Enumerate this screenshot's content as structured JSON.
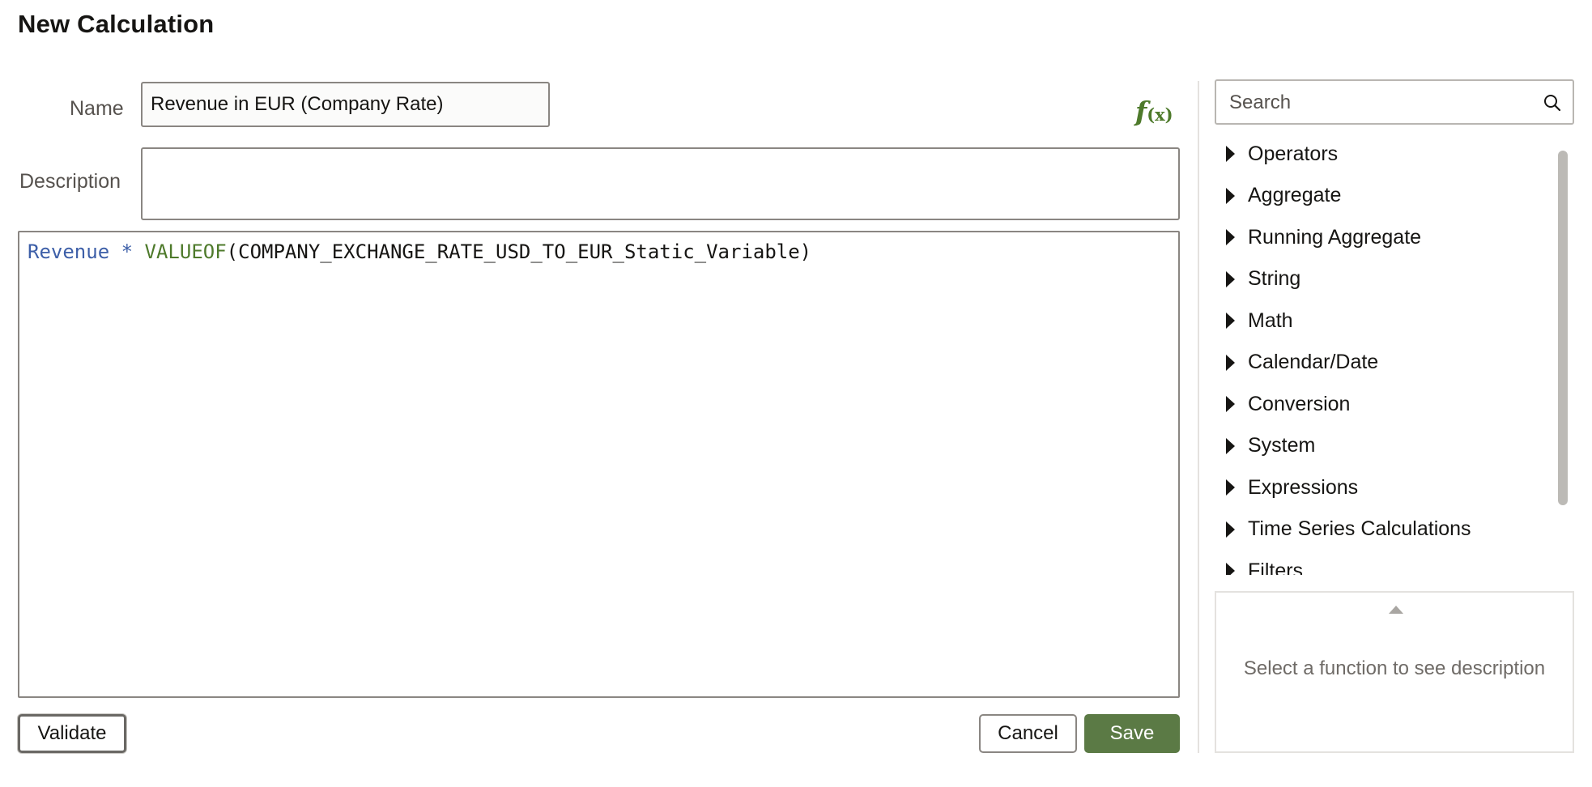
{
  "header": {
    "title": "New Calculation"
  },
  "form": {
    "name_label": "Name",
    "name_value": "Revenue in EUR (Company Rate)",
    "description_label": "Description",
    "description_value": "",
    "fx_icon": "function-icon",
    "fx_f": "f",
    "fx_x": "(x)"
  },
  "editor": {
    "tokens": [
      {
        "type": "column",
        "text": "Revenue"
      },
      {
        "type": "space",
        "text": " "
      },
      {
        "type": "operator",
        "text": "*"
      },
      {
        "type": "space",
        "text": " "
      },
      {
        "type": "function",
        "text": "VALUEOF"
      },
      {
        "type": "text",
        "text": "(COMPANY_EXCHANGE_RATE_USD_TO_EUR_Static_Variable)"
      }
    ],
    "colors": {
      "column": "#3d5fa8",
      "operator": "#3d5fa8",
      "function": "#4e7a2b",
      "text": "#161513"
    }
  },
  "buttons": {
    "validate": "Validate",
    "cancel": "Cancel",
    "save": "Save"
  },
  "colors": {
    "save_bg": "#5b7a45",
    "accent_green": "#4e7a2b"
  },
  "sidebar": {
    "search": {
      "placeholder": "Search",
      "value": "",
      "icon": "search-icon"
    },
    "functions": [
      {
        "label": "Operators"
      },
      {
        "label": "Aggregate"
      },
      {
        "label": "Running Aggregate"
      },
      {
        "label": "String"
      },
      {
        "label": "Math"
      },
      {
        "label": "Calendar/Date"
      },
      {
        "label": "Conversion"
      },
      {
        "label": "System"
      },
      {
        "label": "Expressions"
      },
      {
        "label": "Time Series Calculations"
      },
      {
        "label": "Filters"
      }
    ],
    "description_hint": "Select a function to see description"
  }
}
